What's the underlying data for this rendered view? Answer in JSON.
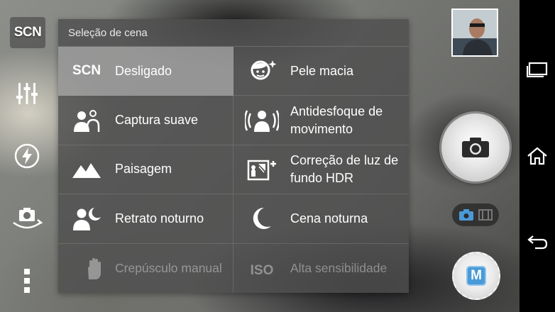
{
  "left_toolbar": {
    "scn_label": "SCN",
    "items": [
      {
        "icon": "adjustments-icon"
      },
      {
        "icon": "flash-auto-icon"
      },
      {
        "icon": "switch-camera-icon"
      },
      {
        "icon": "more-options-icon"
      }
    ]
  },
  "scene_panel": {
    "title": "Seleção de cena",
    "scn_icon_text": "SCN",
    "iso_icon_text": "ISO",
    "items": [
      {
        "label": "Desligado",
        "icon": "scn-off-icon",
        "selected": true,
        "enabled": true
      },
      {
        "label": "Pele macia",
        "icon": "soft-skin-icon",
        "selected": false,
        "enabled": true
      },
      {
        "label": "Captura suave",
        "icon": "soft-snap-icon",
        "selected": false,
        "enabled": true
      },
      {
        "label": "Antidesfoque de movimento",
        "icon": "anti-motion-blur-icon",
        "selected": false,
        "enabled": true
      },
      {
        "label": "Paisagem",
        "icon": "landscape-icon",
        "selected": false,
        "enabled": true
      },
      {
        "label": "Correção de luz de fundo HDR",
        "icon": "backlight-hdr-icon",
        "selected": false,
        "enabled": true
      },
      {
        "label": "Retrato noturno",
        "icon": "night-portrait-icon",
        "selected": false,
        "enabled": true
      },
      {
        "label": "Cena noturna",
        "icon": "night-scene-icon",
        "selected": false,
        "enabled": true
      },
      {
        "label": "Crepúsculo manual",
        "icon": "handheld-twilight-icon",
        "selected": false,
        "enabled": false
      },
      {
        "label": "Alta sensibilidade",
        "icon": "high-sensitivity-icon",
        "selected": false,
        "enabled": false
      }
    ]
  },
  "right_controls": {
    "thumbnail": "last-photo-thumbnail",
    "shutter_icon": "camera-icon",
    "mode_switch": [
      "photo-mode-icon",
      "video-mode-icon"
    ],
    "mode_button_label": "M",
    "accent_color": "#4a9ad8"
  },
  "navbar": {
    "items": [
      "recent-apps-icon",
      "home-icon",
      "back-icon"
    ]
  }
}
